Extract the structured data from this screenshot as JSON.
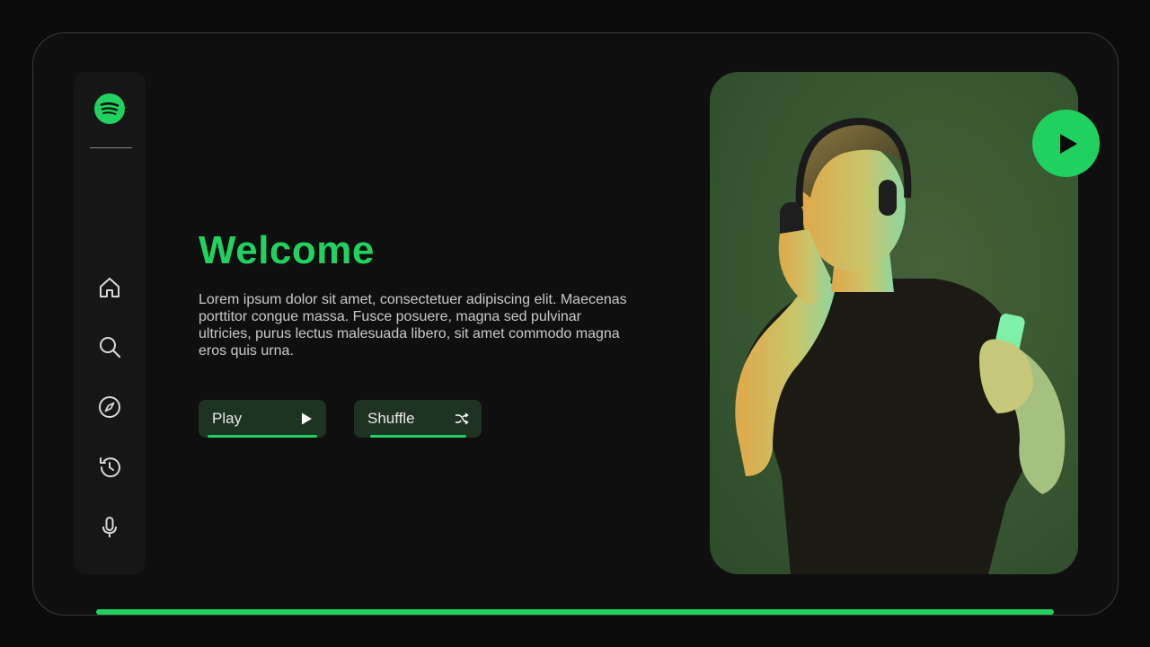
{
  "sidebar": {
    "logo_icon": "spotify-logo",
    "items": [
      {
        "name": "home",
        "icon": "home-icon"
      },
      {
        "name": "search",
        "icon": "search-icon"
      },
      {
        "name": "explore",
        "icon": "compass-icon"
      },
      {
        "name": "history",
        "icon": "history-icon"
      },
      {
        "name": "voice",
        "icon": "microphone-icon"
      }
    ]
  },
  "hero": {
    "title": "Welcome",
    "description": "Lorem ipsum dolor sit amet, consectetuer adipiscing elit. Maecenas porttitor congue massa. Fusce posuere, magna sed pulvinar ultricies, purus lectus malesuada libero, sit amet commodo magna eros quis urna."
  },
  "buttons": {
    "play_label": "Play",
    "shuffle_label": "Shuffle"
  },
  "colors": {
    "accent": "#21d15f",
    "background": "#0f0f10",
    "button_bg": "#1f3323"
  }
}
